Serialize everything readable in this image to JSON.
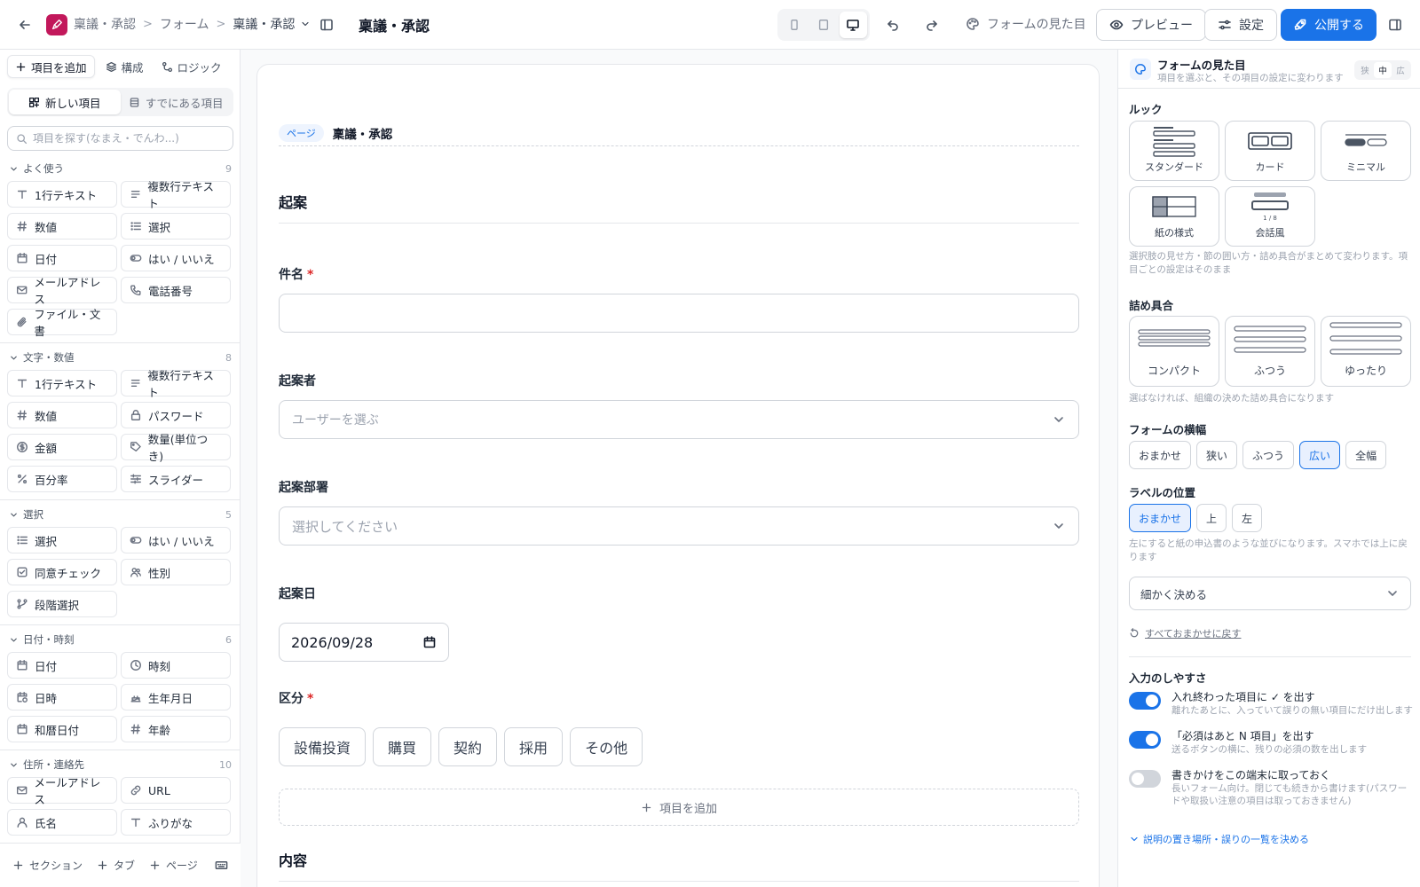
{
  "topbar": {
    "breadcrumb": [
      "稟議・承認",
      "フォーム",
      "稟議・承認"
    ],
    "form_title": "稟議・承認",
    "appearance_label": "フォームの見た目",
    "preview_label": "プレビュー",
    "settings_label": "設定",
    "publish_label": "公開する",
    "accent_color": "#1a73e8",
    "brand_color": "#c2185b"
  },
  "left": {
    "tabs": [
      "項目を追加",
      "構成",
      "ロジック"
    ],
    "segments": [
      "新しい項目",
      "すでにある項目"
    ],
    "search_placeholder": "項目を探す(なまえ・でんわ...)",
    "categories": [
      {
        "name": "よく使う",
        "count": "9",
        "items": [
          {
            "label": "1行テキスト",
            "icon": "text"
          },
          {
            "label": "複数行テキスト",
            "icon": "lines"
          },
          {
            "label": "数値",
            "icon": "hash"
          },
          {
            "label": "選択",
            "icon": "list"
          },
          {
            "label": "日付",
            "icon": "calendar"
          },
          {
            "label": "はい / いいえ",
            "icon": "toggle"
          },
          {
            "label": "メールアドレス",
            "icon": "mail"
          },
          {
            "label": "電話番号",
            "icon": "phone"
          },
          {
            "label": "ファイル・文書",
            "icon": "clip"
          }
        ]
      },
      {
        "name": "文字・数値",
        "count": "8",
        "items": [
          {
            "label": "1行テキスト",
            "icon": "text"
          },
          {
            "label": "複数行テキスト",
            "icon": "lines"
          },
          {
            "label": "数値",
            "icon": "hash"
          },
          {
            "label": "パスワード",
            "icon": "lock"
          },
          {
            "label": "金額",
            "icon": "coin"
          },
          {
            "label": "数量(単位つき)",
            "icon": "tag"
          },
          {
            "label": "百分率",
            "icon": "percent"
          },
          {
            "label": "スライダー",
            "icon": "sliders"
          }
        ]
      },
      {
        "name": "選択",
        "count": "5",
        "items": [
          {
            "label": "選択",
            "icon": "list"
          },
          {
            "label": "はい / いいえ",
            "icon": "toggle"
          },
          {
            "label": "同意チェック",
            "icon": "check"
          },
          {
            "label": "性別",
            "icon": "users"
          },
          {
            "label": "段階選択",
            "icon": "branch"
          }
        ]
      },
      {
        "name": "日付・時刻",
        "count": "6",
        "items": [
          {
            "label": "日付",
            "icon": "calendar"
          },
          {
            "label": "時刻",
            "icon": "clock"
          },
          {
            "label": "日時",
            "icon": "calclock"
          },
          {
            "label": "生年月日",
            "icon": "cake"
          },
          {
            "label": "和暦日付",
            "icon": "calendar"
          },
          {
            "label": "年齢",
            "icon": "hash"
          }
        ]
      },
      {
        "name": "住所・連絡先",
        "count": "10",
        "items": [
          {
            "label": "メールアドレス",
            "icon": "mail"
          },
          {
            "label": "URL",
            "icon": "link"
          },
          {
            "label": "氏名",
            "icon": "user"
          },
          {
            "label": "ふりがな",
            "icon": "text"
          }
        ]
      }
    ],
    "footer": [
      "セクション",
      "タブ",
      "ページ"
    ]
  },
  "canvas": {
    "page_badge": "ページ",
    "page_name": "稟議・承認",
    "section1": "起案",
    "field_subject": "件名",
    "field_author": "起案者",
    "author_placeholder": "ユーザーを選ぶ",
    "field_dept": "起案部署",
    "dept_placeholder": "選択してください",
    "field_date": "起案日",
    "date_value": "2026/09/28",
    "field_category": "区分",
    "category_options": [
      "設備投資",
      "購買",
      "契約",
      "採用",
      "その他"
    ],
    "add_field": "項目を追加",
    "section2": "内容"
  },
  "right": {
    "title": "フォームの見た目",
    "subtitle": "項目を選ぶと、その項目の設定に変わります",
    "size_options": [
      "狭",
      "中",
      "広"
    ],
    "look_label": "ルック",
    "looks": [
      "スタンダード",
      "カード",
      "ミニマル",
      "紙の様式",
      "会話風"
    ],
    "look_thumb_text": "1 / 8",
    "look_help": "選択肢の見せ方・節の囲い方・詰め具合がまとめて変わります。項目ごとの設定はそのまま",
    "density_label": "詰め具合",
    "densities": [
      "コンパクト",
      "ふつう",
      "ゆったり"
    ],
    "density_help": "選ばなければ、組織の決めた詰め具合になります",
    "width_label": "フォームの横幅",
    "widths": [
      "おまかせ",
      "狭い",
      "ふつう",
      "広い",
      "全幅"
    ],
    "label_pos_label": "ラベルの位置",
    "label_positions": [
      "おまかせ",
      "上",
      "左"
    ],
    "label_pos_help": "左にすると紙の申込書のような並びになります。スマホでは上に戻ります",
    "detail_select": "細かく決める",
    "reset_link": "すべておまかせに戻す",
    "usability_label": "入力のしやすさ",
    "toggles": [
      {
        "title": "入れ終わった項目に ✓ を出す",
        "desc": "離れたあとに、入っていて誤りの無い項目にだけ出します",
        "on": true
      },
      {
        "title": "「必須はあと N 項目」を出す",
        "desc": "送るボタンの横に、残りの必須の数を出します",
        "on": true
      },
      {
        "title": "書きかけをこの端末に取っておく",
        "desc": "長いフォーム向け。閉じても続きから書けます(パスワードや取扱い注意の項目は取っておきません)",
        "on": false
      }
    ],
    "expand_link": "説明の置き場所・誤りの一覧を決める"
  }
}
